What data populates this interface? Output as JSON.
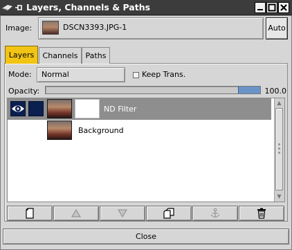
{
  "window": {
    "title": "Layers, Channels & Paths",
    "icons": [
      "window-menu-icon",
      "pin-icon",
      "minimize-icon",
      "maximize-icon",
      "close-window-icon"
    ]
  },
  "image_row": {
    "label": "Image:",
    "selected": "DSCN3393.JPG-1",
    "auto_label": "Auto"
  },
  "tabs": [
    {
      "label": "Layers",
      "active": true
    },
    {
      "label": "Channels",
      "active": false
    },
    {
      "label": "Paths",
      "active": false
    }
  ],
  "mode": {
    "label": "Mode:",
    "value": "Normal",
    "keep_trans_label": "Keep Trans.",
    "keep_trans_checked": false
  },
  "opacity": {
    "label": "Opacity:",
    "value": "100.0"
  },
  "layers": [
    {
      "name": "ND Filter",
      "selected": true,
      "visible": true,
      "has_mask": true
    },
    {
      "name": "Background",
      "selected": false,
      "visible": false,
      "has_mask": false
    }
  ],
  "toolbar": {
    "icons": [
      "new-layer-icon",
      "raise-layer-icon",
      "lower-layer-icon",
      "duplicate-layer-icon",
      "anchor-layer-icon",
      "delete-layer-icon"
    ]
  },
  "close_label": "Close",
  "colors": {
    "titlebar": "#3c3c3c",
    "active_tab": "#f2c414",
    "selected_row": "#8e8e8e",
    "opacity_fill": "#6a93c8",
    "eye_bg": "#0b1f50"
  }
}
